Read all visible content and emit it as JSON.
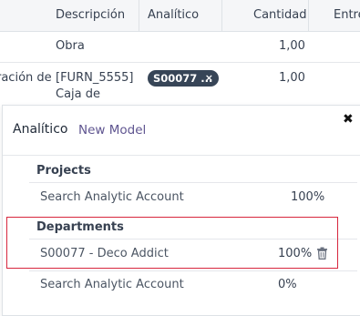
{
  "table": {
    "headers": [
      "Descripción",
      "Analítico",
      "Cantidad",
      "Entre"
    ],
    "rows": [
      {
        "left_text": "",
        "description": "Obra",
        "quantity": "1,00"
      },
      {
        "left_text": "ración de",
        "description_line1": "[FURN_5555]",
        "description_line2": "Caja de",
        "analytic_chip": "S00077 ...",
        "quantity": "1,00"
      }
    ]
  },
  "popover": {
    "title": "Analítico",
    "new_model_label": "New Model",
    "close_glyph": "✖",
    "groups": [
      {
        "name": "Projects",
        "lines": [
          {
            "account": "Search Analytic Account",
            "percent": "100%"
          }
        ]
      },
      {
        "name": "Departments",
        "lines": [
          {
            "account": "S00077 - Deco Addict",
            "percent": "100%"
          },
          {
            "account": "Search Analytic Account",
            "percent": "0%"
          }
        ]
      }
    ]
  },
  "colors": {
    "chip_bg": "#374557",
    "link": "#5f5590",
    "highlight": "#d7263d"
  },
  "icons": {
    "chip_remove": "×",
    "delete": "trash-icon"
  }
}
